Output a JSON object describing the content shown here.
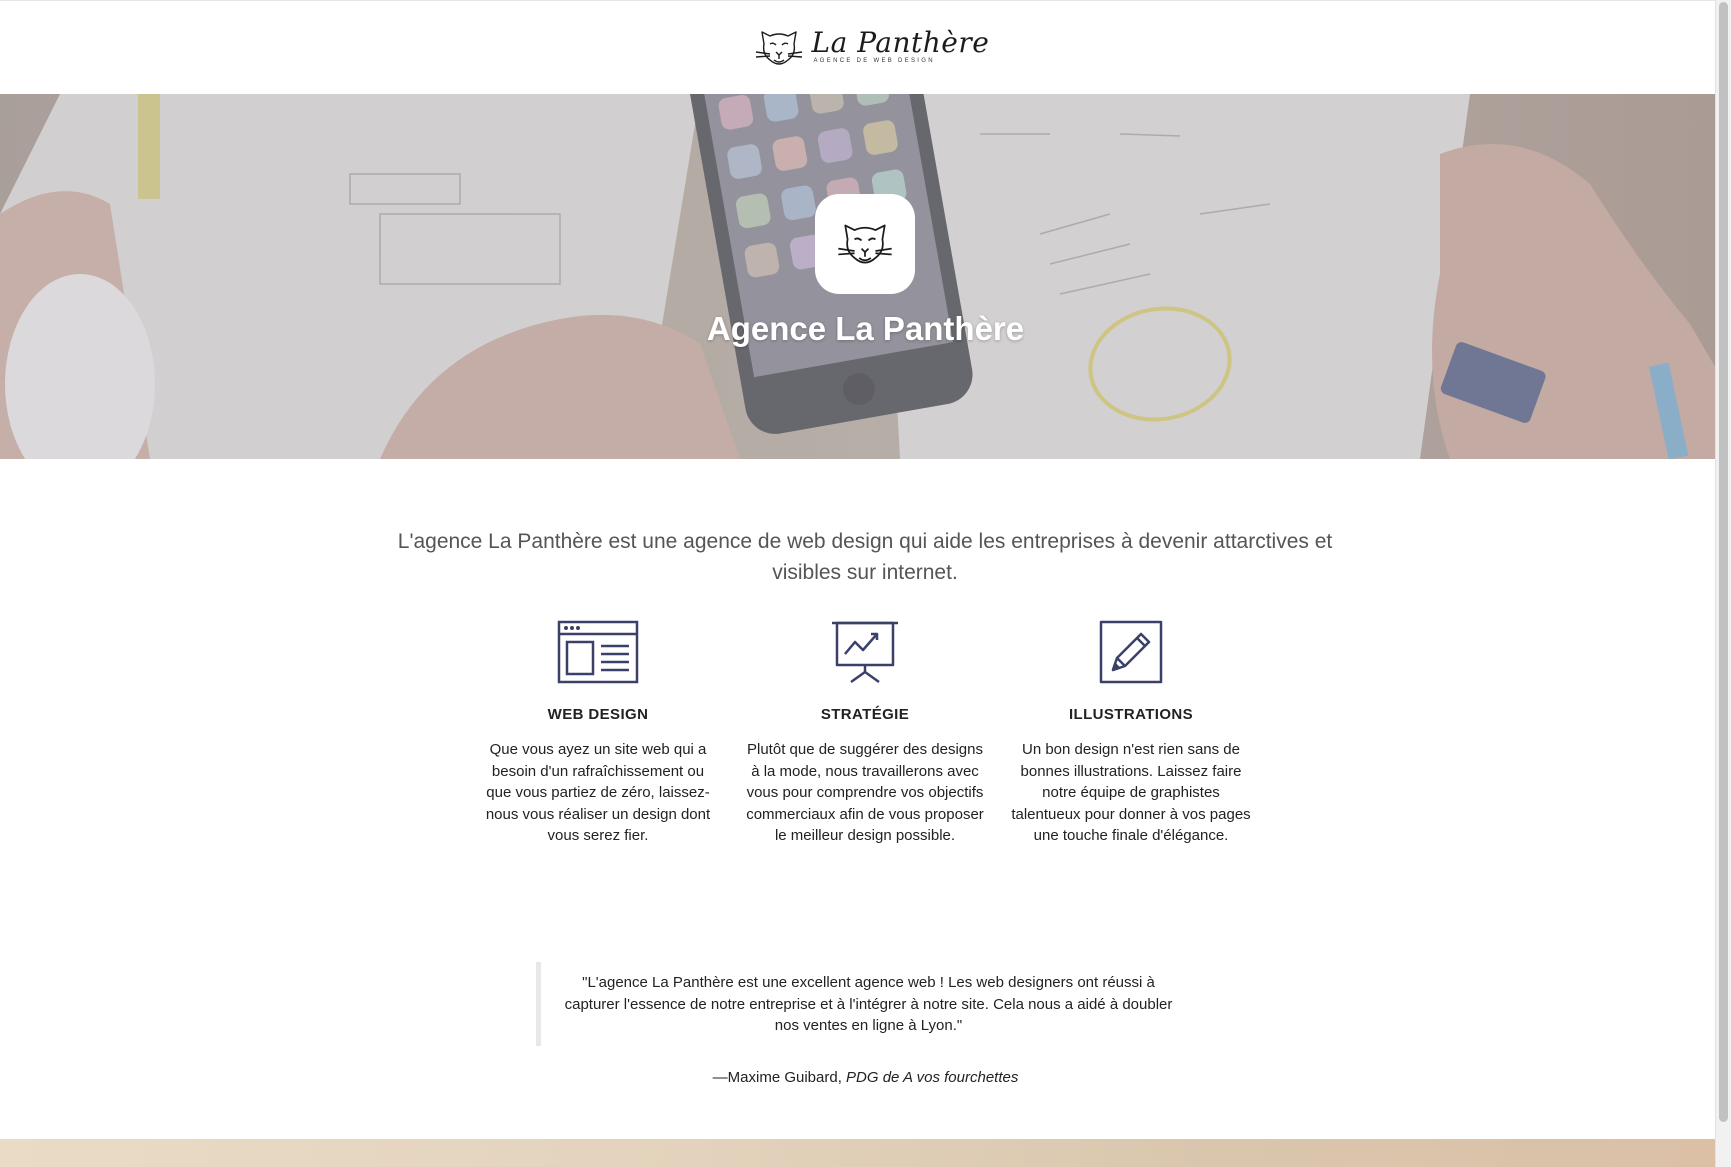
{
  "header": {
    "logo_name": "La Panthère",
    "logo_tagline": "AGENCE DE WEB DESIGN",
    "logo_icon": "panther-head-icon"
  },
  "hero": {
    "badge_icon": "panther-head-icon",
    "title": "Agence La Panthère"
  },
  "intro": {
    "text": "L'agence La Panthère est une agence de web design qui aide les entreprises à devenir attarctives et visibles sur internet."
  },
  "services": [
    {
      "icon": "browser-window-icon",
      "title": "WEB DESIGN",
      "text": "Que vous ayez un site web qui a besoin d'un rafraîchissement ou que vous partiez de zéro, laissez-nous vous réaliser un design dont vous serez fier."
    },
    {
      "icon": "presentation-chart-icon",
      "title": "STRATÉGIE",
      "text": "Plutôt que de suggérer des designs à la mode, nous travaillerons avec vous pour comprendre vos objectifs commerciaux afin de vous proposer le meilleur design possible."
    },
    {
      "icon": "pencil-square-icon",
      "title": "ILLUSTRATIONS",
      "text": "Un bon design n'est rien sans de bonnes illustrations. Laissez faire notre équipe de graphistes talentueux pour donner à vos pages une touche finale d'élégance."
    }
  ],
  "testimonial": {
    "quote": "\"L'agence La Panthère est une excellent agence web ! Les web designers ont réussi à capturer l'essence de notre entreprise et à l'intégrer à notre site. Cela nous a aidé à doubler nos ventes en ligne à Lyon.\"",
    "author": "—Maxime Guibard, ",
    "role": "PDG de A vos fourchettes"
  },
  "colors": {
    "icon_stroke": "#3b4069",
    "hero_title": "#ffffff",
    "body_text": "#222222",
    "intro_text": "#555555"
  }
}
